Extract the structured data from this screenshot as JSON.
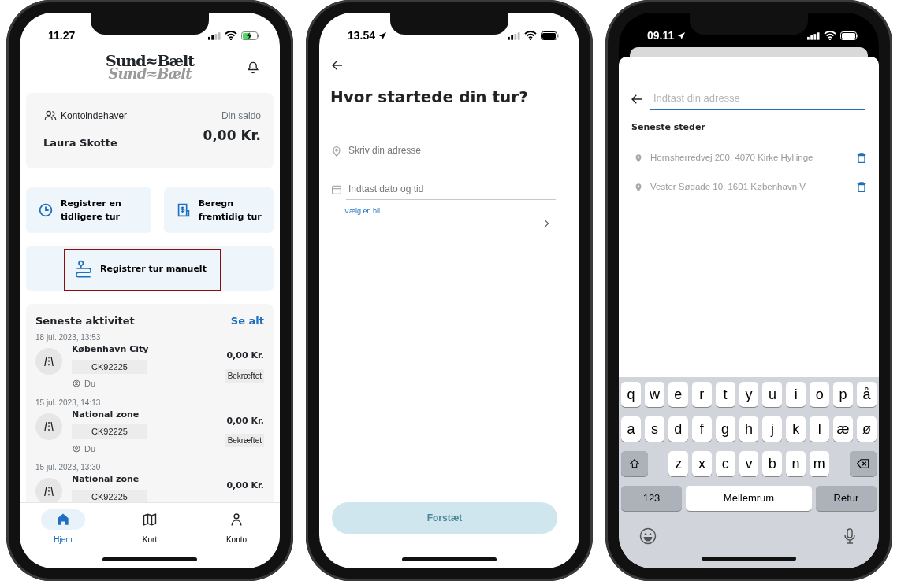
{
  "phones": [
    {
      "kind": "home",
      "status": {
        "time": "11.27",
        "charging": true,
        "location": false
      },
      "logo": [
        "Sund≈Bælt",
        "Sund≈Bælt"
      ],
      "account": {
        "label": "Kontoindehaver",
        "name": "Laura Skotte",
        "balance_label": "Din saldo",
        "balance": "0,00 Kr."
      },
      "actions": [
        {
          "kind": "clock",
          "label": "Registrer en tidligere tur"
        },
        {
          "kind": "receipt",
          "label": "Beregn fremtidig tur"
        }
      ],
      "manual": {
        "label": "Registrer tur manuelt",
        "highlighted": true
      },
      "activity": {
        "title": "Seneste aktivitet",
        "link": "Se alt",
        "items": [
          {
            "date": "18 jul. 2023, 13:53",
            "zone": "København City",
            "plate": "CK92225",
            "driver": "Du",
            "amount": "0,00 Kr.",
            "status": "Bekræftet"
          },
          {
            "date": "15 jul. 2023, 14:13",
            "zone": "National zone",
            "plate": "CK92225",
            "driver": "Du",
            "amount": "0,00 Kr.",
            "status": "Bekræftet"
          },
          {
            "date": "15 jul. 2023, 13:30",
            "zone": "National zone",
            "plate": "CK92225",
            "amount": "0,00 Kr."
          }
        ]
      },
      "nav": [
        {
          "kind": "home",
          "label": "Hjem",
          "selected": true
        },
        {
          "kind": "map",
          "label": "Kort",
          "selected": false
        },
        {
          "kind": "person",
          "label": "Konto",
          "selected": false
        }
      ]
    },
    {
      "kind": "form",
      "status": {
        "time": "13.54",
        "charging": false,
        "location": true
      },
      "title": "Hvor startede din tur?",
      "fields": [
        {
          "kind": "address",
          "placeholder": "Skriv din adresse"
        },
        {
          "kind": "datetime",
          "placeholder": "Indtast dato og tid"
        }
      ],
      "car_select": {
        "label": "Vælg en bil"
      },
      "button": {
        "label": "Forstæt",
        "disabled": true
      }
    },
    {
      "kind": "search",
      "status": {
        "time": "09.11",
        "charging": false,
        "location": true
      },
      "search": {
        "placeholder": "Indtast din adresse"
      },
      "section": "Seneste steder",
      "places": [
        "Hornsherredvej 200, 4070 Kirke Hyllinge",
        "Vester Søgade 10, 1601 København V"
      ],
      "keyboard": {
        "rows": [
          [
            "q",
            "w",
            "e",
            "r",
            "t",
            "y",
            "u",
            "i",
            "o",
            "p",
            "å"
          ],
          [
            "a",
            "s",
            "d",
            "f",
            "g",
            "h",
            "j",
            "k",
            "l",
            "æ",
            "ø"
          ],
          [
            "",
            "",
            "z",
            "x",
            "c",
            "v",
            "b",
            "n",
            "m",
            ""
          ]
        ],
        "numbers": "123",
        "space": "Mellemrum",
        "return": "Retur"
      }
    }
  ]
}
